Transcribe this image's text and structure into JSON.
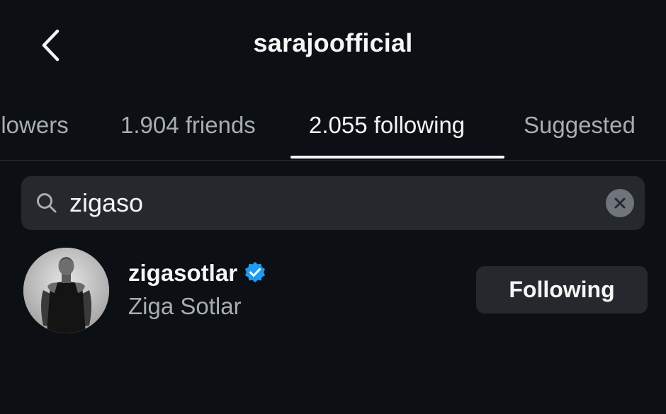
{
  "header": {
    "title": "sarajoofficial",
    "back_icon": "chevron-left-icon"
  },
  "tabs": [
    {
      "label": "llowers",
      "active": false
    },
    {
      "label": "1.904 friends",
      "active": false
    },
    {
      "label": "2.055 following",
      "active": true
    },
    {
      "label": "Suggested",
      "active": false
    }
  ],
  "search": {
    "value": "zigaso",
    "search_icon": "search-icon",
    "clear_icon": "clear-icon"
  },
  "results": [
    {
      "username": "zigasotlar",
      "verified": true,
      "full_name": "Ziga Sotlar",
      "button_label": "Following"
    }
  ],
  "colors": {
    "background": "#0c1014",
    "surface": "#25292e",
    "primary_text": "#f5f5f5",
    "secondary_text": "#a8adb3",
    "verified_badge": "#1d9bf0"
  }
}
